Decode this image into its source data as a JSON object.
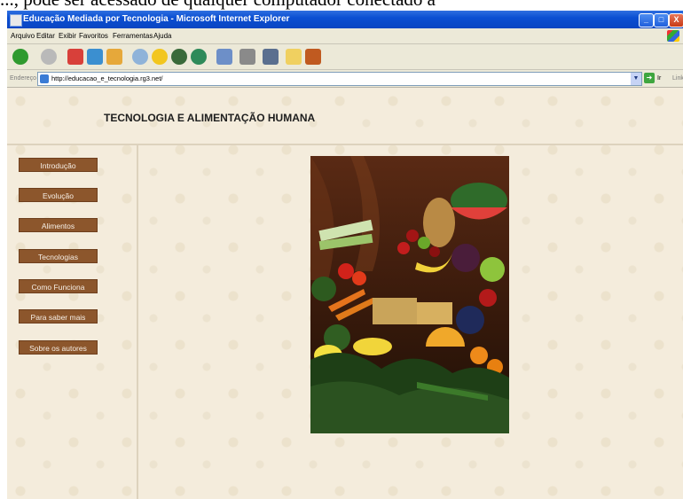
{
  "overlay_text": "..., pode ser acessado de qualquer computador conectado à",
  "window": {
    "title": "Educação Mediada por Tecnologia - Microsoft Internet Explorer",
    "controls": {
      "minimize": "_",
      "maximize": "□",
      "close": "X"
    }
  },
  "menu": [
    "Arquivo",
    "Editar",
    "Exibir",
    "Favoritos",
    "Ferramentas",
    "Ajuda"
  ],
  "toolbar_icons": [
    "back-icon",
    "forward-icon",
    "stop-icon",
    "refresh-icon",
    "home-icon",
    "search-icon",
    "favorites-icon",
    "media-icon",
    "history-icon",
    "mail-icon",
    "print-icon",
    "edit-icon",
    "discuss-icon",
    "messenger-icon"
  ],
  "address": {
    "label": "Endereço",
    "url": "http://educacao_e_tecnologia.rg3.net/",
    "go_label": "Ir",
    "links_label": "Links"
  },
  "page": {
    "heading": "TECNOLOGIA E ALIMENTAÇÃO HUMANA",
    "nav": [
      "Introdução",
      "Evolução",
      "Alimentos",
      "Tecnologias",
      "Como Funciona",
      "Para saber mais",
      "Sobre os autores"
    ],
    "nav_color": "#8c562c",
    "image_alt": "food-photo"
  }
}
